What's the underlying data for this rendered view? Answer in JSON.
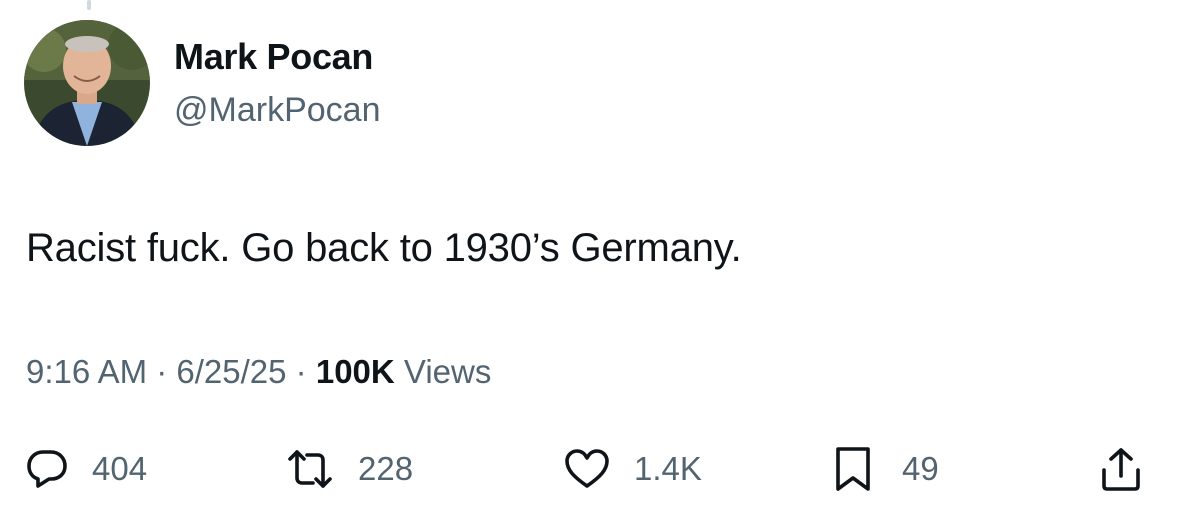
{
  "tweet": {
    "author": {
      "display_name": "Mark Pocan",
      "handle": "@MarkPocan"
    },
    "text": "Racist fuck. Go back to 1930’s Germany.",
    "meta": {
      "time": "9:16 AM",
      "date": "6/25/25",
      "views_count": "100K",
      "views_label": "Views",
      "separator": " · "
    },
    "actions": {
      "replies": "404",
      "reposts": "228",
      "likes": "1.4K",
      "bookmarks": "49"
    }
  },
  "colors": {
    "text_primary": "#0f1419",
    "text_secondary": "#536471",
    "background": "#ffffff"
  },
  "icons": {
    "reply": "reply-icon",
    "repost": "repost-icon",
    "like": "like-icon",
    "bookmark": "bookmark-icon",
    "share": "share-icon"
  }
}
